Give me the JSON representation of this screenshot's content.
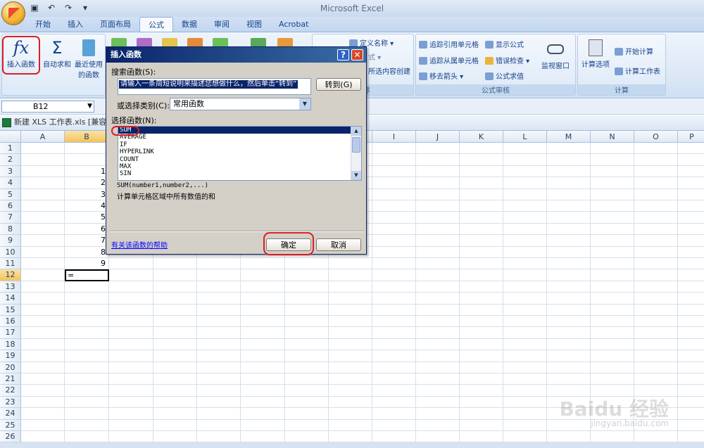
{
  "app": {
    "title": "Microsoft Excel"
  },
  "tabs": [
    "开始",
    "插入",
    "页面布局",
    "公式",
    "数据",
    "审阅",
    "视图",
    "Acrobat"
  ],
  "ribbon": {
    "insert_function_label": "插入函数",
    "autosum_label": "自动求和",
    "recent_label_1": "最近使用",
    "recent_label_2": "的函数",
    "define_name": "定义名称",
    "formula_part": "式",
    "create_from_selection": "所选内容创建",
    "name_group": "名称",
    "trace_precedents": "追踪引用单元格",
    "trace_dependents": "追踪从属单元格",
    "remove_arrows": "移去箭头",
    "show_formulas": "显示公式",
    "error_check": "错误检查",
    "evaluate_formula": "公式求值",
    "watch_window": "监视窗口",
    "auditing_group": "公式审核",
    "calc_options": "计算选项",
    "calc_now": "开始计算",
    "calc_sheet": "计算工作表",
    "calc_group": "计算"
  },
  "formula_bar": {
    "name_box": "B12"
  },
  "file_tab": {
    "label": "新建 XLS 工作表.xls  [兼容"
  },
  "grid": {
    "columns": [
      "A",
      "B",
      "C",
      "D",
      "E",
      "F",
      "G",
      "H",
      "I",
      "J",
      "K",
      "L",
      "M",
      "N",
      "O",
      "P"
    ],
    "rows": [
      "1",
      "2",
      "3",
      "4",
      "5",
      "6",
      "7",
      "8",
      "9",
      "10",
      "11",
      "12",
      "13",
      "14",
      "15",
      "16",
      "17",
      "18",
      "19",
      "20",
      "21",
      "22",
      "23",
      "24",
      "25",
      "26"
    ],
    "b_values": [
      "",
      "",
      "1",
      "2",
      "3",
      "4",
      "5",
      "6",
      "7",
      "8",
      "9"
    ],
    "active_cell_value": "="
  },
  "dialog": {
    "title": "插入函数",
    "help_icon": "?",
    "close_icon": "✕",
    "search_label": "搜索函数(S):",
    "search_value": "请输入一条简短说明来描述您想做什么，然后单击“转到”",
    "goto_button": "转到(G)",
    "category_label": "或选择类别(C):",
    "category_value": "常用函数",
    "list_label": "选择函数(N):",
    "functions": [
      "SUM",
      "AVERAGE",
      "IF",
      "HYPERLINK",
      "COUNT",
      "MAX",
      "SIN"
    ],
    "signature": "SUM(number1,number2,...)",
    "description": "计算单元格区域中所有数值的和",
    "help_link": "有关该函数的帮助",
    "ok_button": "确定",
    "cancel_button": "取消"
  },
  "watermark": {
    "brand": "Baidu 经验",
    "url": "jingyan.baidu.com"
  }
}
